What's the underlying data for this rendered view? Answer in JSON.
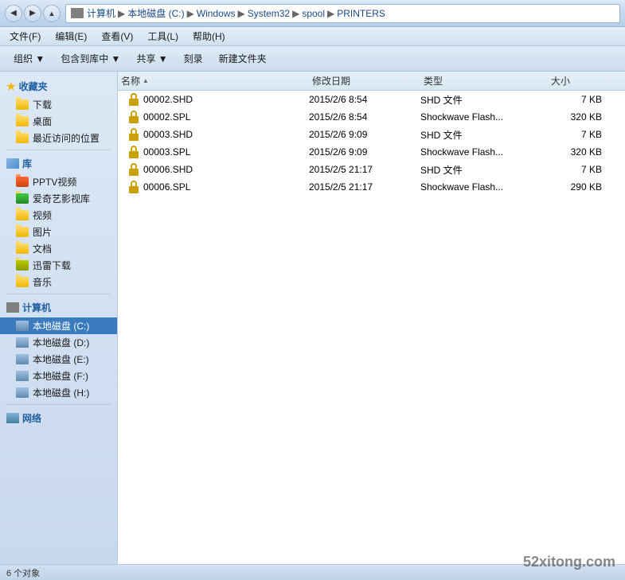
{
  "titlebar": {
    "back_btn": "◀",
    "forward_btn": "▶",
    "breadcrumb": [
      {
        "label": "计算机"
      },
      {
        "label": "本地磁盘 (C:)"
      },
      {
        "label": "Windows"
      },
      {
        "label": "System32"
      },
      {
        "label": "spool"
      },
      {
        "label": "PRINTERS"
      }
    ]
  },
  "menubar": {
    "items": [
      {
        "label": "文件(F)"
      },
      {
        "label": "编辑(E)"
      },
      {
        "label": "查看(V)"
      },
      {
        "label": "工具(L)"
      },
      {
        "label": "帮助(H)"
      }
    ]
  },
  "toolbar": {
    "items": [
      {
        "label": "组织 ▼",
        "has_dropdown": true
      },
      {
        "label": "包含到库中 ▼",
        "has_dropdown": true
      },
      {
        "label": "共享 ▼",
        "has_dropdown": true
      },
      {
        "label": "刻录"
      },
      {
        "label": "新建文件夹"
      }
    ]
  },
  "sidebar": {
    "sections": [
      {
        "name": "favorites",
        "title": "收藏夹",
        "items": [
          {
            "label": "下载"
          },
          {
            "label": "桌面"
          },
          {
            "label": "最近访问的位置"
          }
        ]
      },
      {
        "name": "libraries",
        "title": "库",
        "items": [
          {
            "label": "PPTV视频"
          },
          {
            "label": "爱奇艺影视库"
          },
          {
            "label": "视频"
          },
          {
            "label": "图片"
          },
          {
            "label": "文档"
          },
          {
            "label": "迅雷下载"
          },
          {
            "label": "音乐"
          }
        ]
      },
      {
        "name": "computer",
        "title": "计算机",
        "items": [
          {
            "label": "本地磁盘 (C:)",
            "active": true
          },
          {
            "label": "本地磁盘 (D:)"
          },
          {
            "label": "本地磁盘 (E:)"
          },
          {
            "label": "本地磁盘 (F:)"
          },
          {
            "label": "本地磁盘 (H:)"
          }
        ]
      },
      {
        "name": "network",
        "title": "网络",
        "items": []
      }
    ]
  },
  "file_list": {
    "columns": [
      {
        "label": "名称",
        "sort_arrow": "▲"
      },
      {
        "label": "修改日期"
      },
      {
        "label": "类型"
      },
      {
        "label": "大小"
      }
    ],
    "files": [
      {
        "name": "00002.SHD",
        "date": "2015/2/6 8:54",
        "type": "SHD 文件",
        "size": "7 KB"
      },
      {
        "name": "00002.SPL",
        "date": "2015/2/6 8:54",
        "type": "Shockwave Flash...",
        "size": "320 KB"
      },
      {
        "name": "00003.SHD",
        "date": "2015/2/6 9:09",
        "type": "SHD 文件",
        "size": "7 KB"
      },
      {
        "name": "00003.SPL",
        "date": "2015/2/6 9:09",
        "type": "Shockwave Flash...",
        "size": "320 KB"
      },
      {
        "name": "00006.SHD",
        "date": "2015/2/5 21:17",
        "type": "SHD 文件",
        "size": "7 KB"
      },
      {
        "name": "00006.SPL",
        "date": "2015/2/5 21:17",
        "type": "Shockwave Flash...",
        "size": "290 KB"
      }
    ]
  },
  "status_bar": {
    "text": "6 个对象"
  },
  "watermark": {
    "text": "52xitong.com"
  }
}
